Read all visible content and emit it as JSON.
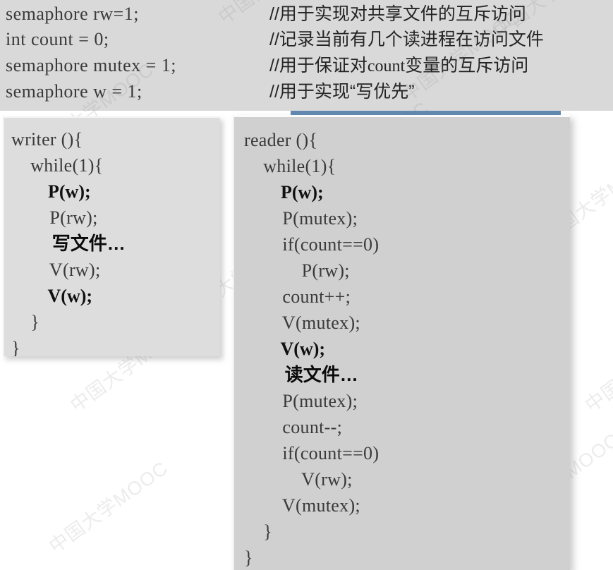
{
  "colors": {
    "header_background": "#d9d9d9",
    "accent_bar": "#6289b0",
    "writer_panel_background": "#dddddd",
    "reader_panel_background": "#d0d0d0",
    "code_text": "#3a3a3a",
    "bold_text": "#101010",
    "page_background": "#ffffff"
  },
  "watermark": {
    "text": "中国大学MOOC"
  },
  "declarations": [
    {
      "code": "semaphore rw=1;",
      "comment_prefix": "//用于实现对共享文件的互斥访问",
      "comment_mono": "",
      "comment_suffix": ""
    },
    {
      "code": "int count = 0;",
      "comment_prefix": "//记录当前有几个读进程在访问文件",
      "comment_mono": "",
      "comment_suffix": ""
    },
    {
      "code": "semaphore mutex = 1;",
      "comment_prefix": "//用于保证对",
      "comment_mono": "count",
      "comment_suffix": "变量的互斥访问"
    },
    {
      "code": "semaphore w = 1;",
      "comment_prefix": "//用于实现“写优先”",
      "comment_mono": "",
      "comment_suffix": ""
    }
  ],
  "writer_block": {
    "title": "writer",
    "lines": [
      {
        "text": "writer (){",
        "style": "normal"
      },
      {
        "text": "    while(1){",
        "style": "normal"
      },
      {
        "text": "        P(w);",
        "style": "bold"
      },
      {
        "text": "        P(rw);",
        "style": "normal"
      },
      {
        "text": "        写文件…",
        "style": "cjk"
      },
      {
        "text": "        V(rw);",
        "style": "normal"
      },
      {
        "text": "        V(w);",
        "style": "bold"
      },
      {
        "text": "    }",
        "style": "normal"
      },
      {
        "text": "}",
        "style": "normal"
      }
    ]
  },
  "reader_block": {
    "title": "reader",
    "lines": [
      {
        "text": "reader (){",
        "style": "normal"
      },
      {
        "text": "    while(1){",
        "style": "normal"
      },
      {
        "text": "        P(w);",
        "style": "bold"
      },
      {
        "text": "        P(mutex);",
        "style": "normal"
      },
      {
        "text": "        if(count==0)",
        "style": "normal"
      },
      {
        "text": "            P(rw);",
        "style": "normal"
      },
      {
        "text": "        count++;",
        "style": "normal"
      },
      {
        "text": "        V(mutex);",
        "style": "normal"
      },
      {
        "text": "        V(w);",
        "style": "bold"
      },
      {
        "text": "        读文件…",
        "style": "cjk"
      },
      {
        "text": "        P(mutex);",
        "style": "normal"
      },
      {
        "text": "        count--;",
        "style": "normal"
      },
      {
        "text": "        if(count==0)",
        "style": "normal"
      },
      {
        "text": "            V(rw);",
        "style": "normal"
      },
      {
        "text": "        V(mutex);",
        "style": "normal"
      },
      {
        "text": "    }",
        "style": "normal"
      },
      {
        "text": "}",
        "style": "normal"
      }
    ]
  }
}
